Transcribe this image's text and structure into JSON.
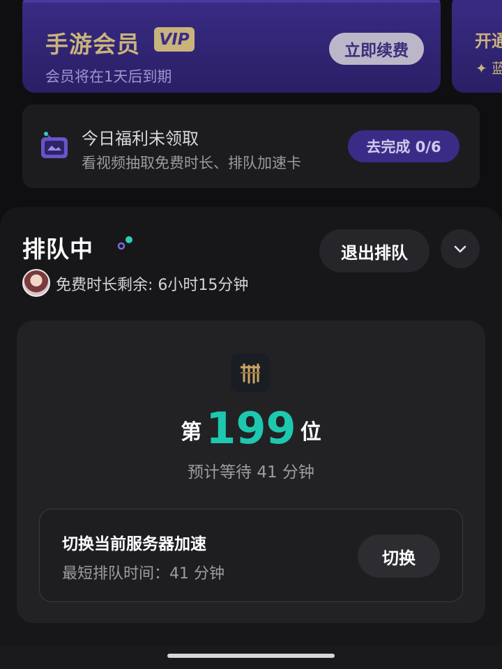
{
  "vip_card": {
    "title": "手游会员",
    "badge": "VIP",
    "subtitle": "会员将在1天后到期",
    "renew_label": "立即续费"
  },
  "vip_card_2": {
    "title": "开通",
    "subtitle": "✦ 蓝"
  },
  "welfare": {
    "title": "今日福利未领取",
    "subtitle": "看视频抽取免费时长、排队加速卡",
    "button_label": "去完成 0/6"
  },
  "queue": {
    "title": "排队中",
    "exit_label": "退出排队",
    "free_time_text": "免费时长剩余: 6小时15分钟",
    "rank_prefix": "第",
    "rank_number": "199",
    "rank_suffix": "位",
    "eta": "预计等待 41 分钟",
    "server": {
      "title": "切换当前服务器加速",
      "subtitle": "最短排队时间：41 分钟",
      "switch_label": "切换"
    }
  },
  "colors": {
    "accent_teal": "#1ec8b0",
    "vip_gold": "#c9b37c",
    "vip_purple": "#3a2c86"
  },
  "icons": {
    "welfare": "tv-icon",
    "status": "connecting-dots-icon",
    "collapse": "chevron-down-icon",
    "game": "game-logo-icon"
  }
}
